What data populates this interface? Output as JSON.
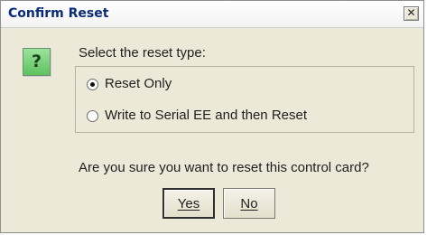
{
  "dialog": {
    "title": "Confirm Reset",
    "close_glyph": "✕",
    "icon": "question-icon",
    "icon_glyph": "?",
    "prompt": "Select the reset type:",
    "options": [
      {
        "label": "Reset Only",
        "selected": true
      },
      {
        "label": "Write to Serial EE and then Reset",
        "selected": false
      }
    ],
    "question": "Are you sure you want to reset this control card?",
    "buttons": {
      "yes": "Yes",
      "no": "No"
    }
  }
}
